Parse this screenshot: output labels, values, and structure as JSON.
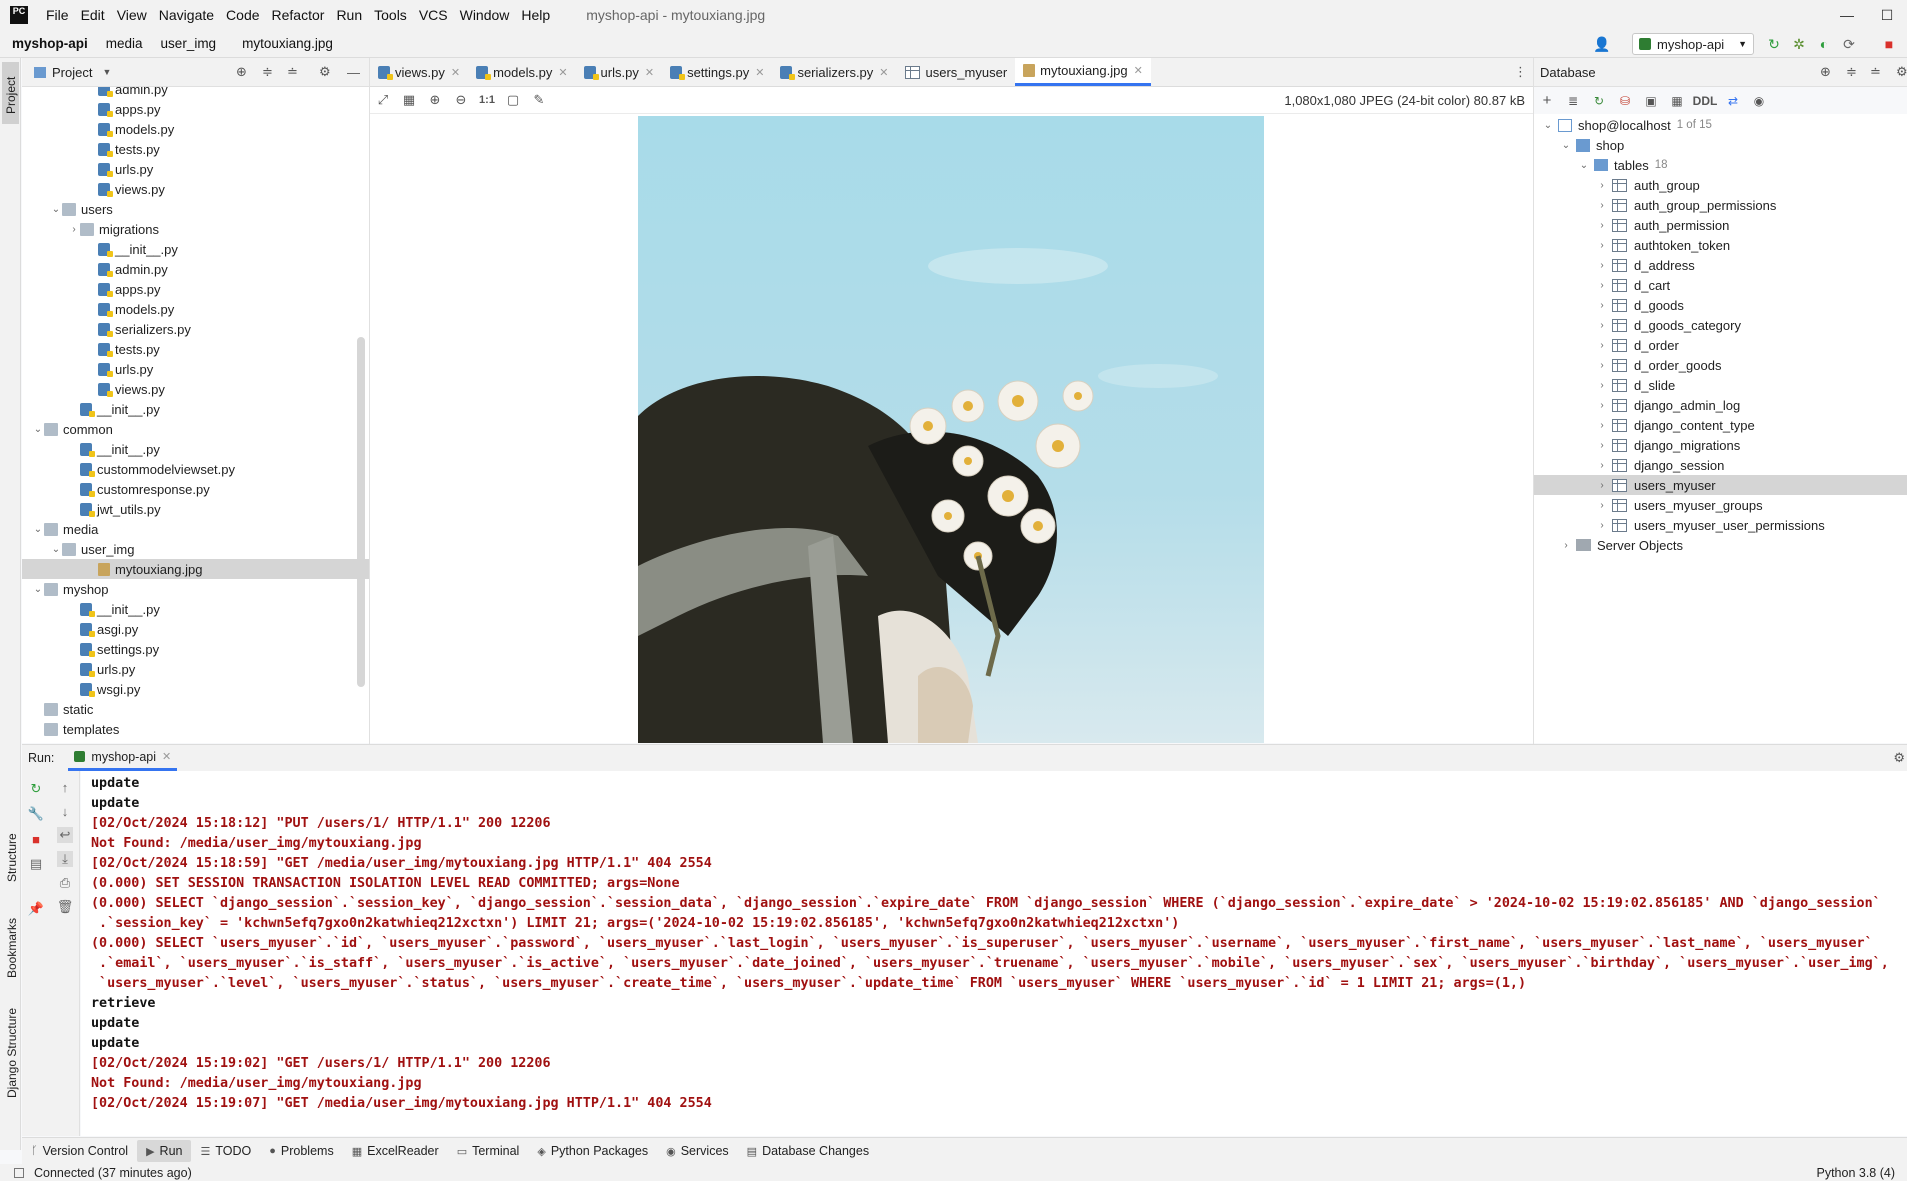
{
  "menubar": {
    "items": [
      "File",
      "Edit",
      "View",
      "Navigate",
      "Code",
      "Refactor",
      "Run",
      "Tools",
      "VCS",
      "Window",
      "Help"
    ],
    "window_title": "myshop-api - mytouxiang.jpg"
  },
  "navbar": {
    "breadcrumbs": [
      "myshop-api",
      "media",
      "user_img",
      "mytouxiang.jpg"
    ],
    "run_config": "myshop-api"
  },
  "left_strip": {
    "project": "Project",
    "structure": "Structure",
    "bookmarks": "Bookmarks",
    "django_structure": "Django Structure"
  },
  "project_panel": {
    "title": "Project",
    "rows": [
      {
        "label": "admin.py",
        "type": "py",
        "indent": 3,
        "arrow": ""
      },
      {
        "label": "apps.py",
        "type": "py",
        "indent": 3,
        "arrow": ""
      },
      {
        "label": "models.py",
        "type": "py",
        "indent": 3,
        "arrow": ""
      },
      {
        "label": "tests.py",
        "type": "py",
        "indent": 3,
        "arrow": ""
      },
      {
        "label": "urls.py",
        "type": "py",
        "indent": 3,
        "arrow": ""
      },
      {
        "label": "views.py",
        "type": "py",
        "indent": 3,
        "arrow": ""
      },
      {
        "label": "users",
        "type": "folder",
        "indent": 1,
        "arrow": "v"
      },
      {
        "label": "migrations",
        "type": "folder",
        "indent": 2,
        "arrow": ">"
      },
      {
        "label": "__init__.py",
        "type": "py",
        "indent": 3,
        "arrow": ""
      },
      {
        "label": "admin.py",
        "type": "py",
        "indent": 3,
        "arrow": ""
      },
      {
        "label": "apps.py",
        "type": "py",
        "indent": 3,
        "arrow": ""
      },
      {
        "label": "models.py",
        "type": "py",
        "indent": 3,
        "arrow": ""
      },
      {
        "label": "serializers.py",
        "type": "py",
        "indent": 3,
        "arrow": ""
      },
      {
        "label": "tests.py",
        "type": "py",
        "indent": 3,
        "arrow": ""
      },
      {
        "label": "urls.py",
        "type": "py",
        "indent": 3,
        "arrow": ""
      },
      {
        "label": "views.py",
        "type": "py",
        "indent": 3,
        "arrow": ""
      },
      {
        "label": "__init__.py",
        "type": "py",
        "indent": 2,
        "arrow": ""
      },
      {
        "label": "common",
        "type": "folder",
        "indent": 0,
        "arrow": "v"
      },
      {
        "label": "__init__.py",
        "type": "py",
        "indent": 2,
        "arrow": ""
      },
      {
        "label": "custommodelviewset.py",
        "type": "py",
        "indent": 2,
        "arrow": ""
      },
      {
        "label": "customresponse.py",
        "type": "py",
        "indent": 2,
        "arrow": ""
      },
      {
        "label": "jwt_utils.py",
        "type": "py",
        "indent": 2,
        "arrow": ""
      },
      {
        "label": "media",
        "type": "folder",
        "indent": 0,
        "arrow": "v"
      },
      {
        "label": "user_img",
        "type": "folder",
        "indent": 1,
        "arrow": "v"
      },
      {
        "label": "mytouxiang.jpg",
        "type": "img",
        "indent": 3,
        "arrow": "",
        "selected": true
      },
      {
        "label": "myshop",
        "type": "folder",
        "indent": 0,
        "arrow": "v"
      },
      {
        "label": "__init__.py",
        "type": "py",
        "indent": 2,
        "arrow": ""
      },
      {
        "label": "asgi.py",
        "type": "py",
        "indent": 2,
        "arrow": ""
      },
      {
        "label": "settings.py",
        "type": "py",
        "indent": 2,
        "arrow": ""
      },
      {
        "label": "urls.py",
        "type": "py",
        "indent": 2,
        "arrow": ""
      },
      {
        "label": "wsgi.py",
        "type": "py",
        "indent": 2,
        "arrow": ""
      },
      {
        "label": "static",
        "type": "folder",
        "indent": 0,
        "arrow": ""
      },
      {
        "label": "templates",
        "type": "folder",
        "indent": 0,
        "arrow": ""
      }
    ]
  },
  "editor_tabs": [
    {
      "label": "views.py",
      "icon": "py"
    },
    {
      "label": "models.py",
      "icon": "py"
    },
    {
      "label": "urls.py",
      "icon": "py"
    },
    {
      "label": "settings.py",
      "icon": "py"
    },
    {
      "label": "serializers.py",
      "icon": "py"
    },
    {
      "label": "users_myuser",
      "icon": "table",
      "no_close": true
    },
    {
      "label": "mytouxiang.jpg",
      "icon": "img",
      "active": true
    }
  ],
  "image_viewer": {
    "actual_size_label": "1:1",
    "info": "1,080x1,080 JPEG (24-bit color) 80.87 kB"
  },
  "database_panel": {
    "title": "Database",
    "ddl_label": "DDL",
    "connection": "shop@localhost",
    "connection_badge": "1 of 15",
    "schema": "shop",
    "tables_label": "tables",
    "tables_count": "18",
    "tables": [
      "auth_group",
      "auth_group_permissions",
      "auth_permission",
      "authtoken_token",
      "d_address",
      "d_cart",
      "d_goods",
      "d_goods_category",
      "d_order",
      "d_order_goods",
      "d_slide",
      "django_admin_log",
      "django_content_type",
      "django_migrations",
      "django_session",
      "users_myuser",
      "users_myuser_groups",
      "users_myuser_user_permissions"
    ],
    "selected_table": "users_myuser",
    "server_objects": "Server Objects"
  },
  "run_panel": {
    "label": "Run:",
    "tab": "myshop-api",
    "lines": [
      {
        "text": "update",
        "plain": true
      },
      {
        "text": "update",
        "plain": true
      },
      {
        "text": "[02/Oct/2024 15:18:12] \"PUT /users/1/ HTTP/1.1\" 200 12206"
      },
      {
        "text": "Not Found: /media/user_img/mytouxiang.jpg"
      },
      {
        "text": "[02/Oct/2024 15:18:59] \"GET /media/user_img/mytouxiang.jpg HTTP/1.1\" 404 2554"
      },
      {
        "text": "(0.000) SET SESSION TRANSACTION ISOLATION LEVEL READ COMMITTED; args=None"
      },
      {
        "text": "(0.000) SELECT `django_session`.`session_key`, `django_session`.`session_data`, `django_session`.`expire_date` FROM `django_session` WHERE (`django_session`.`expire_date` > '2024-10-02 15:19:02.856185' AND `django_session`"
      },
      {
        "text": " .`session_key` = 'kchwn5efq7gxo0n2katwhieq212xctxn') LIMIT 21; args=('2024-10-02 15:19:02.856185', 'kchwn5efq7gxo0n2katwhieq212xctxn')"
      },
      {
        "text": "(0.000) SELECT `users_myuser`.`id`, `users_myuser`.`password`, `users_myuser`.`last_login`, `users_myuser`.`is_superuser`, `users_myuser`.`username`, `users_myuser`.`first_name`, `users_myuser`.`last_name`, `users_myuser`"
      },
      {
        "text": " .`email`, `users_myuser`.`is_staff`, `users_myuser`.`is_active`, `users_myuser`.`date_joined`, `users_myuser`.`truename`, `users_myuser`.`mobile`, `users_myuser`.`sex`, `users_myuser`.`birthday`, `users_myuser`.`user_img`,"
      },
      {
        "text": " `users_myuser`.`level`, `users_myuser`.`status`, `users_myuser`.`create_time`, `users_myuser`.`update_time` FROM `users_myuser` WHERE `users_myuser`.`id` = 1 LIMIT 21; args=(1,)"
      },
      {
        "text": "retrieve",
        "plain": true
      },
      {
        "text": "update",
        "plain": true
      },
      {
        "text": "update",
        "plain": true
      },
      {
        "text": "[02/Oct/2024 15:19:02] \"GET /users/1/ HTTP/1.1\" 200 12206"
      },
      {
        "text": "Not Found: /media/user_img/mytouxiang.jpg"
      },
      {
        "text": "[02/Oct/2024 15:19:07] \"GET /media/user_img/mytouxiang.jpg HTTP/1.1\" 404 2554"
      }
    ]
  },
  "bottom_tabs": [
    {
      "label": "Version Control",
      "icon": "ᚴ"
    },
    {
      "label": "Run",
      "icon": "▶",
      "active": true
    },
    {
      "label": "TODO",
      "icon": "☰"
    },
    {
      "label": "Problems",
      "icon": "●"
    },
    {
      "label": "ExcelReader",
      "icon": "▦"
    },
    {
      "label": "Terminal",
      "icon": "▭"
    },
    {
      "label": "Python Packages",
      "icon": "◈"
    },
    {
      "label": "Services",
      "icon": "◉"
    },
    {
      "label": "Database Changes",
      "icon": "▤"
    }
  ],
  "status": {
    "left": "Connected (37 minutes ago)",
    "right": "Python 3.8 (4)"
  },
  "colors": {
    "accent": "#3574f0",
    "error_text": "#a01010",
    "selection": "#d5d5d5"
  }
}
